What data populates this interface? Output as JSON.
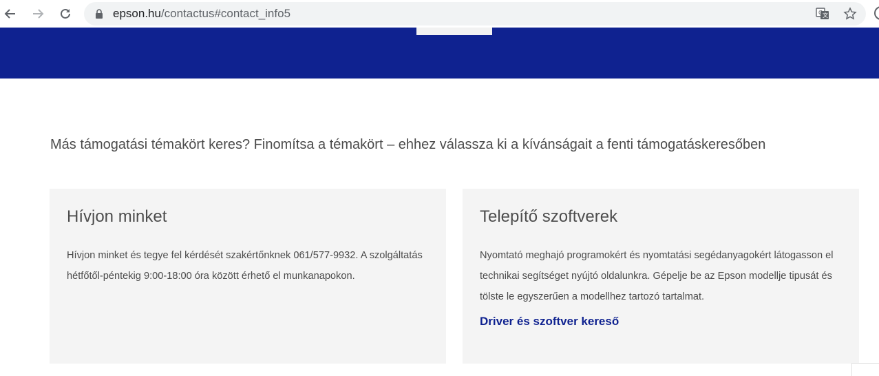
{
  "browser": {
    "url_host": "epson.hu",
    "url_path": "/contactus#contact_info5",
    "icons": {
      "back": "arrow-left-icon",
      "forward": "arrow-right-icon",
      "reload": "reload-icon",
      "lock": "lock-icon",
      "translate": "translate-icon",
      "bookmark": "star-icon"
    }
  },
  "page": {
    "intro_text": "Más támogatási témakört keres? Finomítsa a témakört – ehhez válassza ki a kívánságait a fenti támogatáskeresőben",
    "cards": [
      {
        "title": "Hívjon minket",
        "body": "Hívjon minket és tegye fel kérdését szakértőnknek 061/577-9932. A szolgáltatás hétfőtől-péntekig 9:00-18:00 óra között érhető el munkanapokon."
      },
      {
        "title": "Telepítő szoftverek",
        "body": "Nyomtató meghajó programokért és nyomtatási segédanyagokért látogasson el technikai segítséget nyújtó oldalunkra.  Gépelje be az Epson modellje tipusát és tölste le egyszerűen a modellhez tartozó tartalmat.",
        "link": "Driver és szoftver kereső"
      }
    ]
  },
  "colors": {
    "brand_blue": "#0f2290",
    "card_bg": "#f4f4f4",
    "text": "#4b4b4b"
  }
}
